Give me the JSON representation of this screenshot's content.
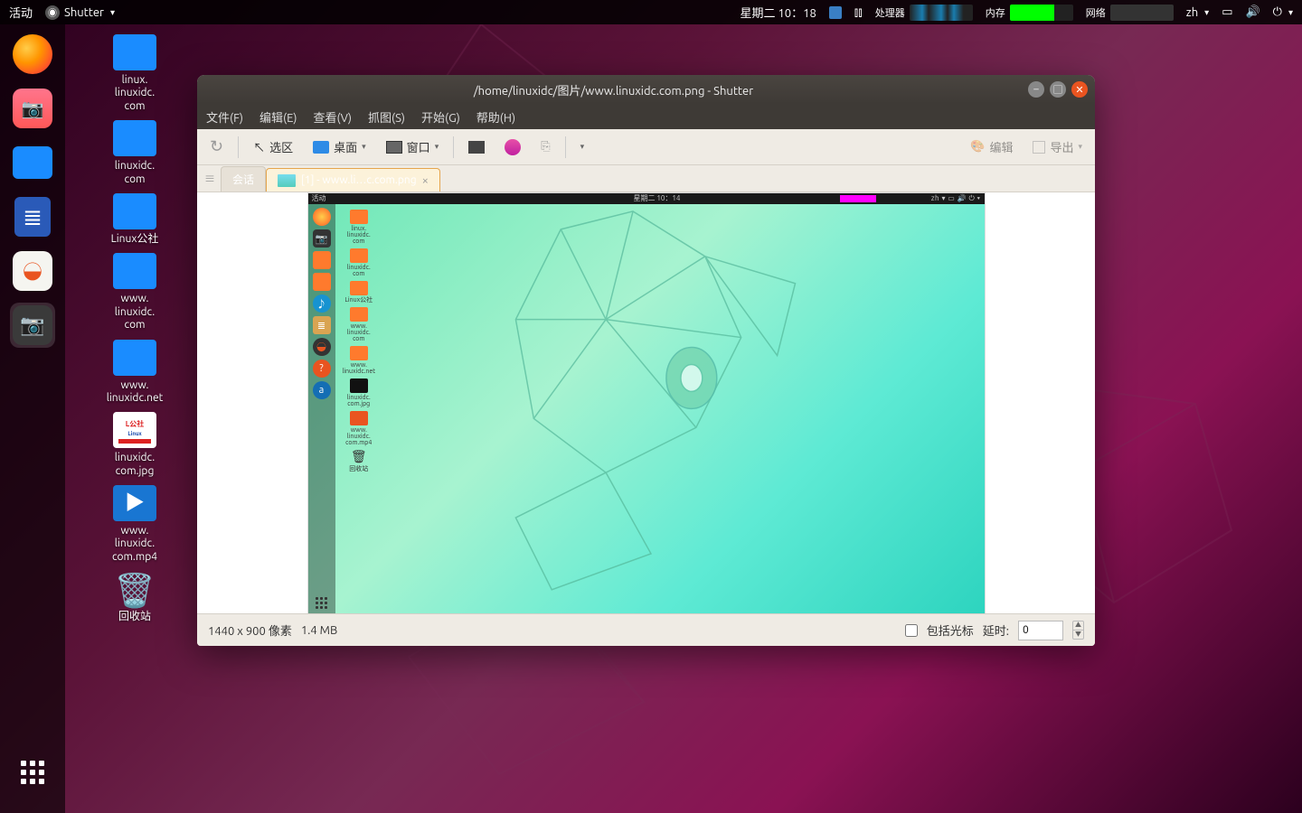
{
  "topbar": {
    "activities": "活动",
    "app": "Shutter",
    "datetime": "星期二 10：18",
    "cpu_label": "处理器",
    "mem_label": "内存",
    "net_label": "网络",
    "ime": "zh"
  },
  "desktop_icons": [
    {
      "type": "folder",
      "label": "linux.\nlinuxidc.\ncom"
    },
    {
      "type": "folder",
      "label": "linuxidc.\ncom"
    },
    {
      "type": "folder",
      "label": "Linux公社"
    },
    {
      "type": "folder",
      "label": "www.\nlinuxidc.\ncom"
    },
    {
      "type": "folder",
      "label": "www.\nlinuxidc.net"
    },
    {
      "type": "img",
      "label": "linuxidc.\ncom.jpg"
    },
    {
      "type": "vid",
      "label": "www.\nlinuxidc.\ncom.mp4"
    },
    {
      "type": "trash",
      "label": "回收站"
    }
  ],
  "window": {
    "title": "/home/linuxidc/图片/www.linuxidc.com.png - Shutter",
    "menubar": [
      "文件(F)",
      "编辑(E)",
      "查看(V)",
      "抓图(S)",
      "开始(G)",
      "帮助(H)"
    ],
    "toolbar": {
      "select": "选区",
      "desktop": "桌面",
      "window": "窗口",
      "edit": "编辑",
      "export": "导出"
    },
    "tabs": {
      "session": "会话",
      "shot": "[1] - www.li…c.com.png"
    },
    "preview": {
      "mini_time": "星期二 10：14",
      "mini_ime": "zh",
      "desk_items": [
        "linux.\nlinuxidc.\ncom",
        "linuxidc.\ncom",
        "Linux公社",
        "www.\nlinuxidc.\ncom",
        "www.\nlinuxidc.net",
        "linuxidc.\ncom.jpg",
        "www.\nlinuxidc.\ncom.mp4",
        "回收站"
      ]
    },
    "status": {
      "dims": "1440 x 900 像素",
      "size": "1.4 MB",
      "cursor_checkbox": "包括光标",
      "delay_label": "延时:",
      "delay_value": "0"
    }
  }
}
